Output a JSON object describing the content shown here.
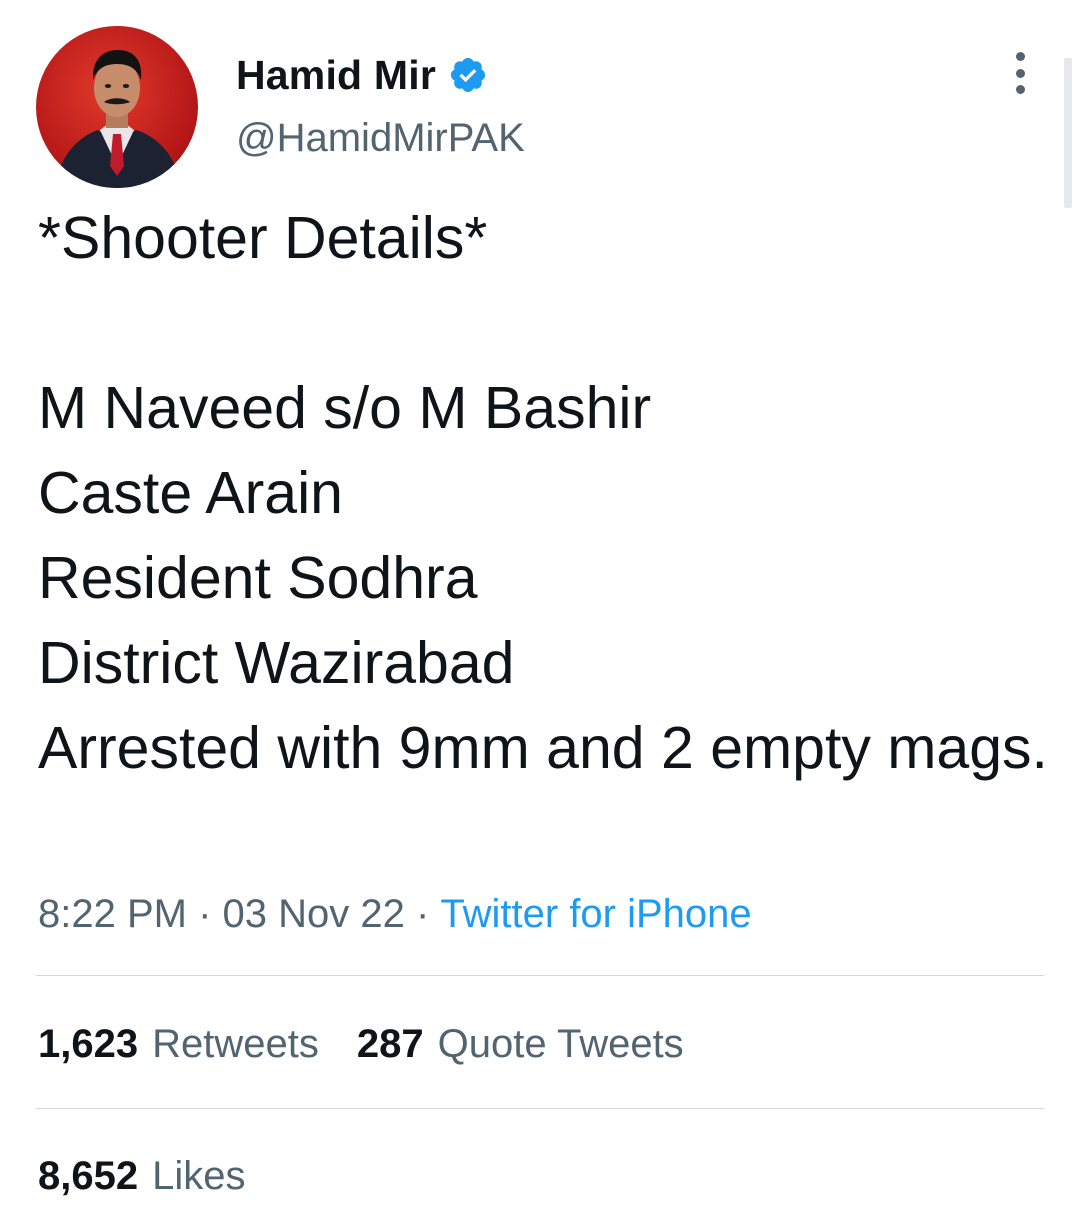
{
  "author": {
    "display_name": "Hamid Mir",
    "handle": "@HamidMirPAK",
    "verified": true,
    "avatar_icon": "avatar-photo-icon"
  },
  "tweet": {
    "text": "*Shooter Details*\n\nM Naveed s/o M Bashir\nCaste Arain\nResident Sodhra\nDistrict Wazirabad\nArrested with 9mm and 2 empty mags."
  },
  "meta": {
    "time": "8:22 PM",
    "separator": " · ",
    "date": "03 Nov 22",
    "source": "Twitter for iPhone"
  },
  "stats": {
    "retweets": {
      "count": "1,623",
      "label": "Retweets"
    },
    "quote_tweets": {
      "count": "287",
      "label": "Quote Tweets"
    },
    "likes": {
      "count": "8,652",
      "label": "Likes"
    }
  },
  "icons": {
    "verified": "verified-badge-icon",
    "more": "more-options-icon"
  },
  "colors": {
    "text_primary": "#0f1419",
    "text_secondary": "#536471",
    "accent": "#1d9bf0",
    "divider": "#cfd9de",
    "avatar_background": "#c8161a"
  }
}
